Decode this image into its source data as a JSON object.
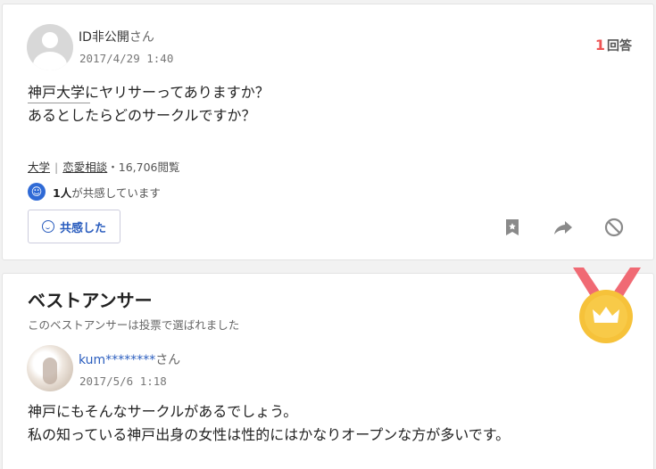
{
  "question": {
    "user_id": "ID非公開",
    "honorific": "さん",
    "date": "2017/4/29 1:40",
    "answer_count": "1",
    "answer_count_label": "回答",
    "text_line1": "神戸大学にヤリサーってありますか？",
    "text_line2": "あるとしたらどのサークルですか？",
    "category1": "大学",
    "category_separator": "|",
    "category2": "恋愛相談",
    "views": "・16,706閲覧",
    "empathy_count": "1人",
    "empathy_text": "が共感しています",
    "empathy_button": "共感した"
  },
  "best_answer": {
    "title": "ベストアンサー",
    "subtitle": "このベストアンサーは投票で選ばれました",
    "user_id": "kum********",
    "honorific": "さん",
    "date": "2017/5/6 1:18",
    "text_line1": "神戸にもそんなサークルがあるでしょう。",
    "text_line2": "私の知っている神戸出身の女性は性的にはかなりオープンな方が多いです。"
  },
  "colors": {
    "accent_blue": "#2a5dbe",
    "answer_count_red": "#ee5555",
    "medal_gold": "#f6c23a",
    "medal_ribbon": "#f06a74"
  },
  "icons": [
    "user-avatar-icon",
    "empathy-icon",
    "bookmark-icon",
    "share-icon",
    "block-icon",
    "best-answer-medal-icon"
  ]
}
